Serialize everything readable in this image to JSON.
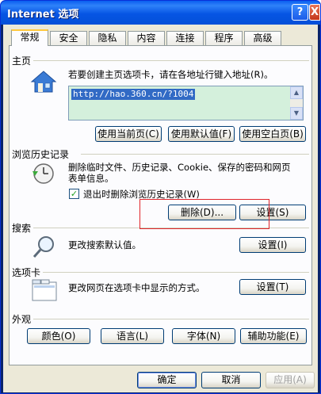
{
  "window": {
    "title": "Internet 选项",
    "help_glyph": "?",
    "close_glyph": "X"
  },
  "tabs": [
    "常规",
    "安全",
    "隐私",
    "内容",
    "连接",
    "程序",
    "高级"
  ],
  "home": {
    "section_title": "主页",
    "description": "若要创建主页选项卡，请在各地址行键入地址(R)。",
    "url": "http://hao.360.cn/?1004",
    "buttons": [
      "使用当前页(C)",
      "使用默认值(F)",
      "使用空白页(B)"
    ]
  },
  "history": {
    "section_title": "浏览历史记录",
    "description_line1": "删除临时文件、历史记录、Cookie、保存的密码和网页",
    "description_line2": "表单信息。",
    "checkbox_label": "退出时删除浏览历史记录(W)",
    "checkbox_checked": true,
    "delete_label": "删除(D)...",
    "settings_label": "设置(S)"
  },
  "search": {
    "section_title": "搜索",
    "description": "更改搜索默认值。",
    "settings_label": "设置(I)"
  },
  "tabs_section": {
    "section_title": "选项卡",
    "description": "更改网页在选项卡中显示的方式。",
    "settings_label": "设置(T)"
  },
  "appearance": {
    "section_title": "外观",
    "buttons": [
      "颜色(O)",
      "语言(L)",
      "字体(N)",
      "辅助功能(E)"
    ]
  },
  "footer": {
    "ok_label": "确定",
    "cancel_label": "取消",
    "apply_label": "应用(A)"
  },
  "colors": {
    "highlight_box": "#E0242A",
    "title_bar": "#0A5EF0"
  }
}
